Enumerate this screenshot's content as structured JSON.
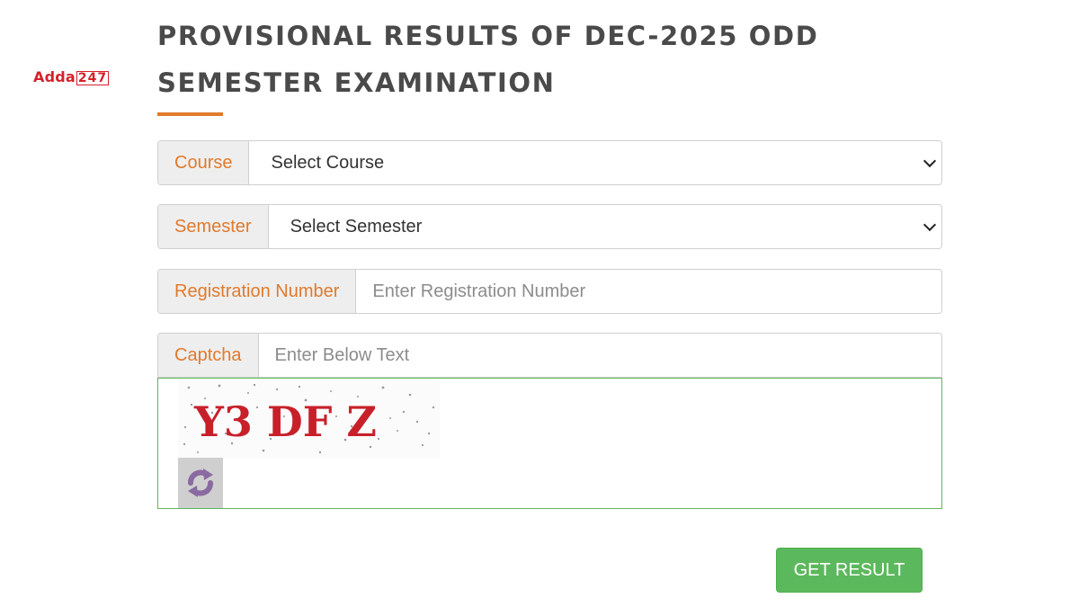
{
  "logo": {
    "brand": "Adda",
    "number": "247"
  },
  "page": {
    "title_line1": "PROVISIONAL RESULTS OF DEC-2025 ODD",
    "title_line2": "SEMESTER EXAMINATION"
  },
  "form": {
    "course": {
      "label": "Course",
      "value": "Select Course"
    },
    "semester": {
      "label": "Semester",
      "value": "Select Semester"
    },
    "registration": {
      "label": "Registration Number",
      "placeholder": "Enter Registration Number"
    },
    "captcha": {
      "label": "Captcha",
      "placeholder": "Enter Below Text",
      "code": "Y3 DF Z"
    },
    "submit_label": "GET RESULT"
  },
  "colors": {
    "accent": "#e07a2c",
    "title": "#4a4a4a",
    "success": "#5cb85c",
    "captcha_text": "#c8202a",
    "logo": "#d6202a"
  },
  "icons": {
    "refresh": "refresh-icon",
    "dropdown": "chevron-down-icon"
  }
}
